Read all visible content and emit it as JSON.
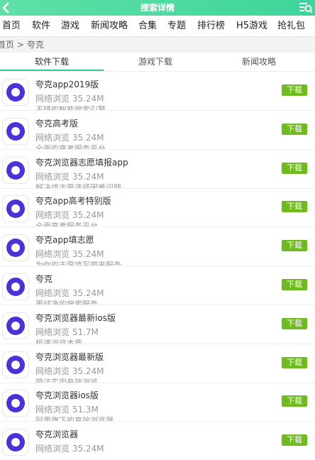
{
  "header": {
    "title": "搜索详情"
  },
  "nav": [
    "首页",
    "软件",
    "游戏",
    "新闻攻略",
    "合集",
    "专题",
    "排行榜",
    "H5游戏",
    "抢礼包"
  ],
  "breadcrumb": {
    "home": "首页",
    "sep": ">",
    "current": "夸克"
  },
  "tabs": [
    "软件下载",
    "游戏下载",
    "新闻攻略"
  ],
  "accent": "#37c88f",
  "download_color": "#6fba1f",
  "items": [
    {
      "name": "夸克app2019版",
      "meta": "网络浏览 35.24M",
      "desc": "不错的智能搜索引擎",
      "btn": "下载"
    },
    {
      "name": "夸克高考版",
      "meta": "网络浏览 35.24M",
      "desc": "全面的高考服务平台",
      "btn": "下载"
    },
    {
      "name": "夸克浏览器志愿填报app",
      "meta": "网络浏览 35.24M",
      "desc": "解决填志愿选择困难问题",
      "btn": "下载"
    },
    {
      "name": "夸克app高考特别版",
      "meta": "网络浏览 35.24M",
      "desc": "全面高考服务平台",
      "btn": "下载"
    },
    {
      "name": "夸克app填志愿",
      "meta": "网络浏览 35.24M",
      "desc": "为你的志愿填写带来服务",
      "btn": "下载"
    },
    {
      "name": "夸克",
      "meta": "网络浏览 35.24M",
      "desc": "更纯净的搜索服务",
      "btn": "下载"
    },
    {
      "name": "夸克浏览器最新ios版",
      "meta": "网络浏览 51.7M",
      "desc": "极速浏览本质",
      "btn": "下载"
    },
    {
      "name": "夸克浏览器最新版",
      "meta": "网络浏览 35.24M",
      "desc": "简洁实用有效浏览",
      "btn": "下载"
    },
    {
      "name": "夸克浏览器ios版",
      "meta": "网络浏览 51.3M",
      "desc": "阿里旗下的高效浏览器",
      "btn": "下载"
    },
    {
      "name": "夸克浏览器",
      "meta": "网络浏览 35.24M",
      "desc": "",
      "btn": "下载"
    }
  ]
}
